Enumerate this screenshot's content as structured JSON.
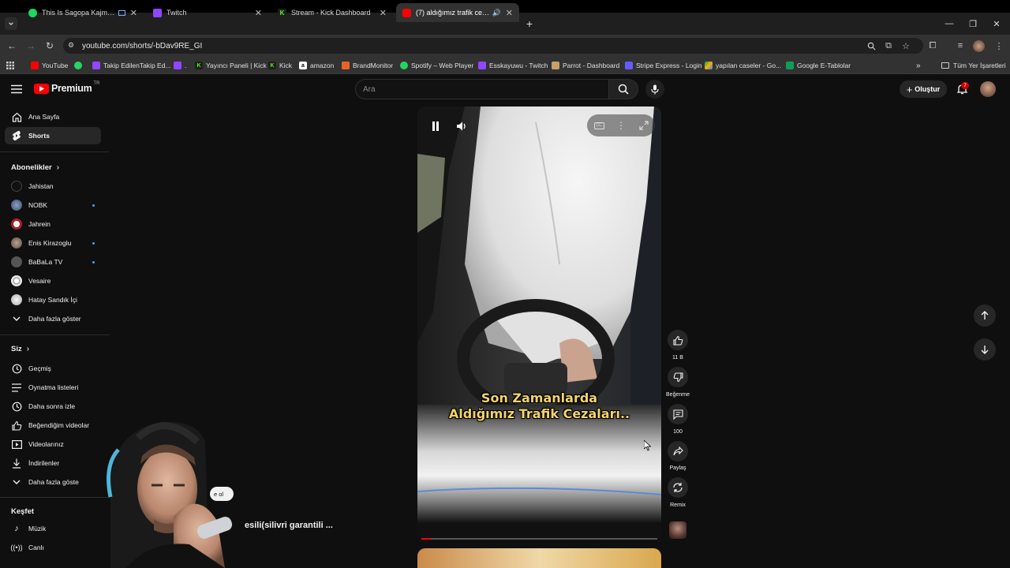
{
  "browser": {
    "tabs": [
      {
        "label": "This Is Sagopa Kajmer | Spotify",
        "active": false,
        "icon": "spotify-icon",
        "color": "#1ed760"
      },
      {
        "label": "Twitch",
        "active": false,
        "icon": "twitch-icon",
        "color": "#9146ff"
      },
      {
        "label": "Stream - Kick Dashboard",
        "active": false,
        "icon": "kick-icon",
        "color": "#53fc18"
      },
      {
        "label": "(7) aldığımız trafik cezaları",
        "active": true,
        "icon": "youtube-icon",
        "color": "#ff0000"
      }
    ],
    "url": "youtube.com/shorts/-bDav9RE_GI",
    "bookmarks": [
      {
        "label": "YouTube",
        "icon": "youtube-icon",
        "color": "#ff0000"
      },
      {
        "label": "",
        "icon": "whatsapp-icon",
        "color": "#25d366"
      },
      {
        "label": "Takip EdilenTakip Ed...",
        "icon": "twitch-icon",
        "color": "#9146ff"
      },
      {
        "label": ".",
        "icon": "twitch-icon",
        "color": "#9146ff"
      },
      {
        "label": "Yayıncı Paneli | Kick",
        "icon": "kick-icon",
        "color": "#53fc18"
      },
      {
        "label": "Kick",
        "icon": "kick-icon",
        "color": "#53fc18"
      },
      {
        "label": "amazon",
        "icon": "amazon-icon",
        "color": "#ffffff"
      },
      {
        "label": "BrandMonitor",
        "icon": "brandmonitor-icon",
        "color": "#e8632b"
      },
      {
        "label": "Spotify – Web Player",
        "icon": "spotify-icon",
        "color": "#1ed760"
      },
      {
        "label": "Esskayuwu - Twitch",
        "icon": "twitch-icon",
        "color": "#9146ff"
      },
      {
        "label": "Parrot - Dashboard",
        "icon": "parrot-icon",
        "color": "#c8a06a"
      },
      {
        "label": "Stripe Express - Login",
        "icon": "stripe-icon",
        "color": "#635bff"
      },
      {
        "label": "yapılan caseler - Go...",
        "icon": "google-drive-icon",
        "color": "#f4b400"
      },
      {
        "label": "Google E-Tablolar",
        "icon": "google-sheets-icon",
        "color": "#0f9d58"
      }
    ],
    "all_bookmarks": "Tüm Yer İşaretleri"
  },
  "youtube": {
    "logo_text": "Premium",
    "region": "TR",
    "search_placeholder": "Ara",
    "create_label": "Oluştur",
    "notification_count": "7",
    "sidebar": {
      "main": [
        {
          "label": "Ana Sayfa",
          "icon": "home-icon",
          "active": false
        },
        {
          "label": "Shorts",
          "icon": "shorts-icon",
          "active": true
        }
      ],
      "subscriptions_title": "Abonelikler",
      "subscriptions": [
        {
          "label": "Jahistan",
          "new": false,
          "avatar_color": "#222222"
        },
        {
          "label": "NOBK",
          "new": true,
          "avatar_color": "#5b6b8a"
        },
        {
          "label": "Jahrein",
          "new": false,
          "avatar_color": "#b01e2b"
        },
        {
          "label": "Enis Kirazoglu",
          "new": true,
          "avatar_color": "#8c7b6e"
        },
        {
          "label": "BaBaLa TV",
          "new": true,
          "avatar_color": "#555555"
        },
        {
          "label": "Vesaire",
          "new": false,
          "avatar_color": "#e6e6e6"
        },
        {
          "label": "Hatay Sandık İçi",
          "new": false,
          "avatar_color": "#d8d8d8"
        }
      ],
      "show_more_subs": "Daha fazla göster",
      "you_title": "Siz",
      "you": [
        {
          "label": "Geçmiş",
          "icon": "history-icon"
        },
        {
          "label": "Oynatma listeleri",
          "icon": "playlists-icon"
        },
        {
          "label": "Daha sonra izle",
          "icon": "watch-later-icon"
        },
        {
          "label": "Beğendiğim videolar",
          "icon": "liked-icon"
        },
        {
          "label": "Videolarınız",
          "icon": "your-videos-icon"
        },
        {
          "label": "İndirilenler",
          "icon": "downloads-icon"
        }
      ],
      "show_more_you": "Daha fazla göste",
      "explore_title": "Keşfet",
      "explore": [
        {
          "label": "Müzik",
          "icon": "music-icon"
        },
        {
          "label": "Canlı",
          "icon": "live-icon"
        }
      ]
    },
    "short": {
      "caption_line1": "Son Zamanlarda",
      "caption_line2": "Aldığımız Trafik Cezaları..",
      "actions": [
        {
          "label": "11 B",
          "icon": "like-icon"
        },
        {
          "label": "Beğenme",
          "icon": "dislike-icon"
        },
        {
          "label": "100",
          "icon": "comment-icon"
        },
        {
          "label": "Paylaş",
          "icon": "share-icon"
        },
        {
          "label": "Remix",
          "icon": "remix-icon"
        }
      ],
      "subscribe_fragment": "e ol",
      "title_fragment": "esili(silivri garantili ..."
    }
  }
}
